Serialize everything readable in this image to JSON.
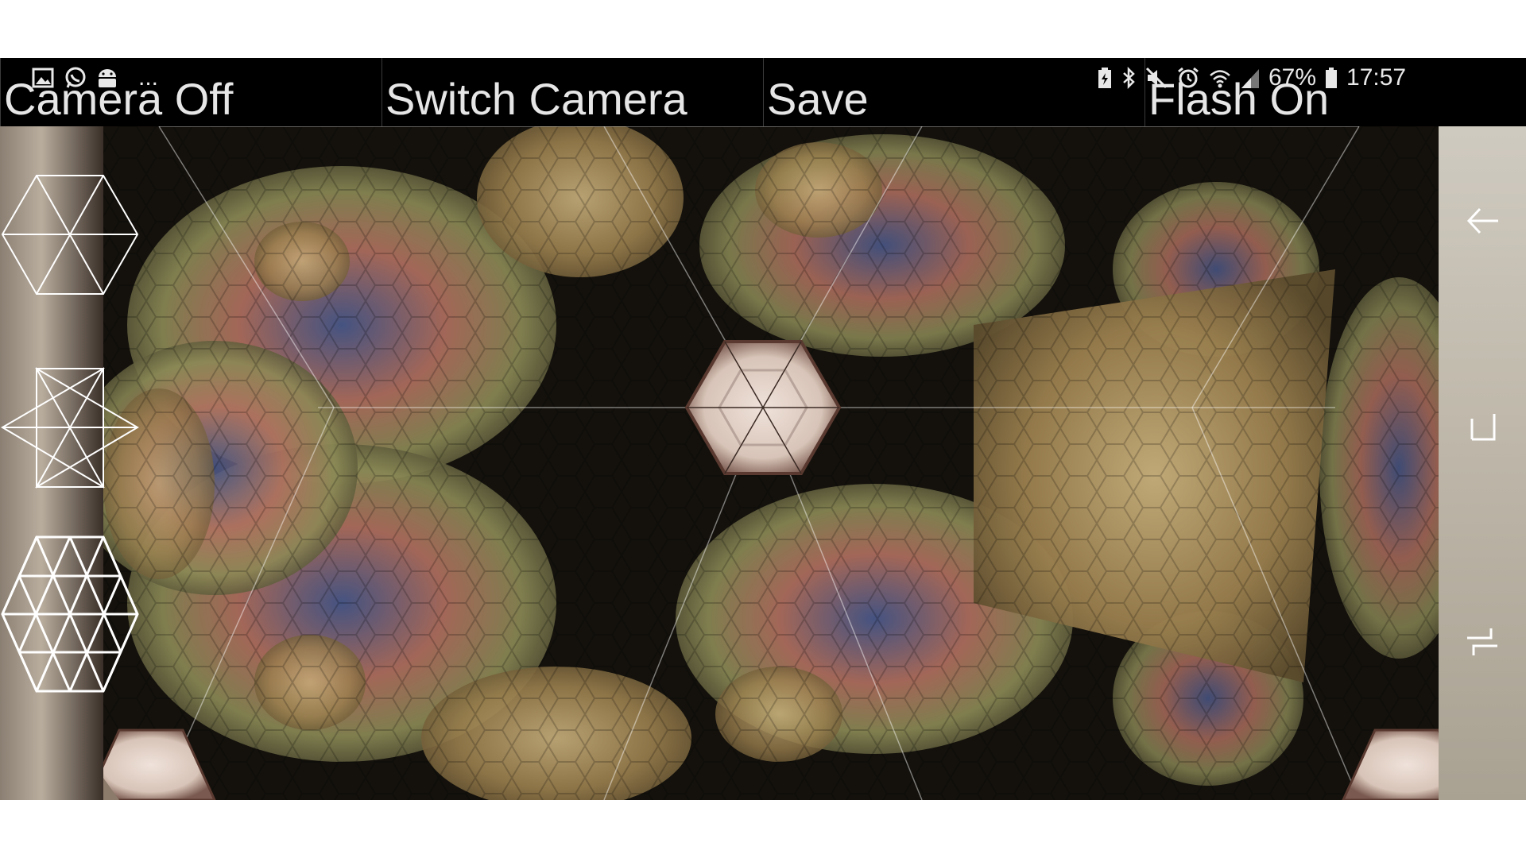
{
  "toolbar": {
    "camera_off_label": "Camera Off",
    "switch_camera_label": "Switch Camera",
    "save_label": "Save",
    "flash_on_label": "Flash On"
  },
  "status_bar": {
    "battery_percent": "67%",
    "time": "17:57",
    "more_label": "...",
    "left_icons": [
      "image-icon",
      "whatsapp-icon",
      "android-icon"
    ],
    "right_icons": [
      "battery-charging-icon",
      "bluetooth-icon",
      "mute-icon",
      "alarm-icon",
      "wifi-icon",
      "signal-icon",
      "battery-icon"
    ]
  },
  "pattern_selector": {
    "options": [
      "hexagon-6-icon",
      "star-12-icon",
      "hex-grid-24-icon"
    ]
  },
  "navigation": {
    "buttons": [
      "back-icon",
      "home-icon",
      "recents-icon"
    ]
  },
  "colors": {
    "bar_background": "#000000",
    "bar_text": "#e6e6e6",
    "kaleido_gold": "#a08a5c",
    "kaleido_blue": "#4a5a8a",
    "kaleido_pink": "#b87060",
    "center_hex": "#e8dad0"
  }
}
